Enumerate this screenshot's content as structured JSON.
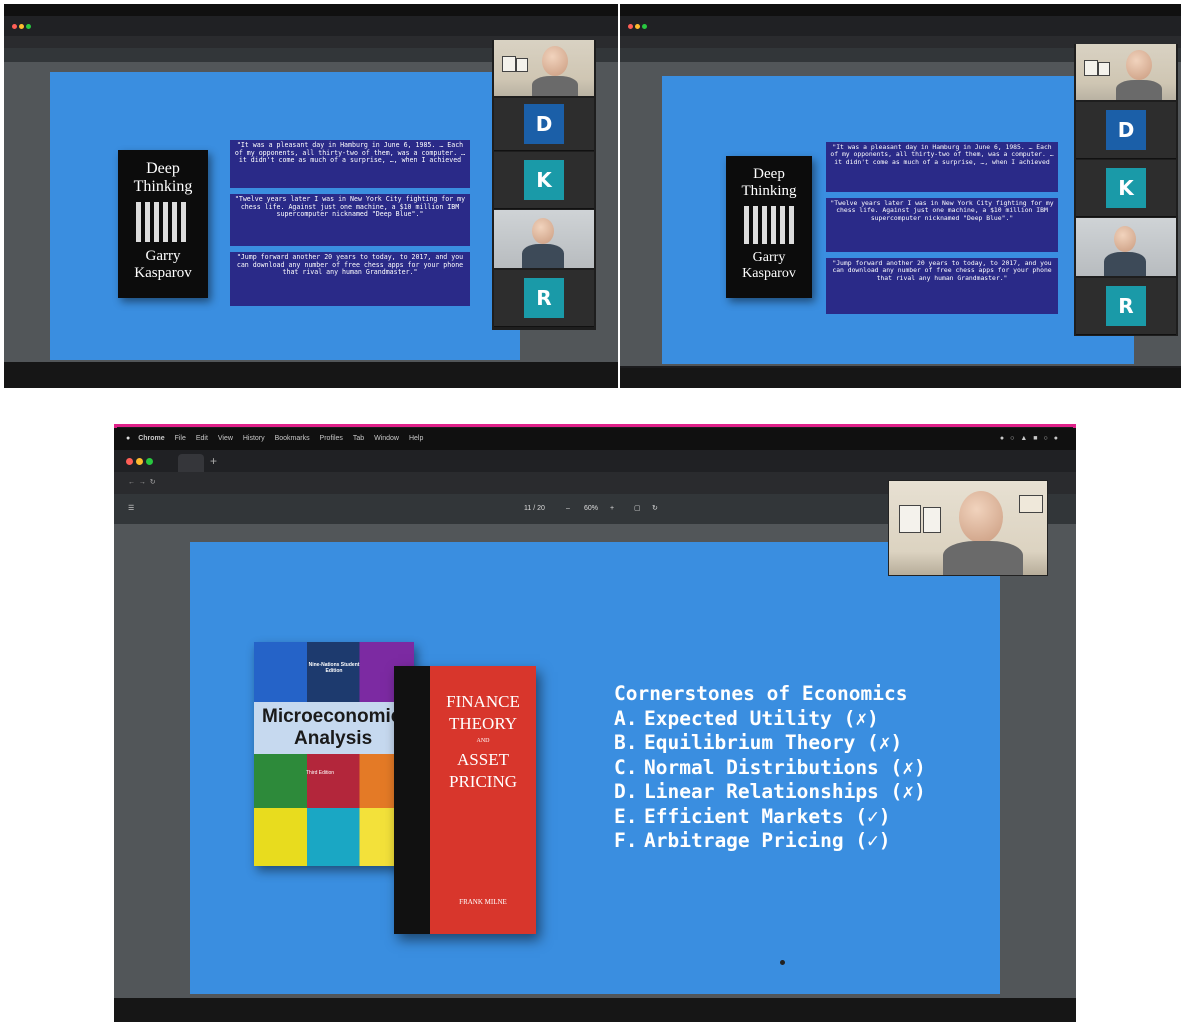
{
  "top_left": {
    "quotes": [
      "\"It was a pleasant day in Hamburg in June 6, 1985. … Each of my opponents, all thirty-two of them, was a computer. … it didn't come as much of a surprise, …, when I achieved",
      "\"Twelve years later I was in New York City fighting for my chess life. Against just one machine, a $10 million IBM supercomputer nicknamed \"Deep Blue\".\"",
      "\"Jump forward another 20 years to today, to 2017, and you can download any number of free chess apps for your phone that rival any human Grandmaster.\""
    ],
    "book": {
      "title1": "Deep",
      "title2": "Thinking",
      "author1": "Garry",
      "author2": "Kasparov"
    },
    "participants": [
      "D",
      "K",
      "R"
    ]
  },
  "top_right": {
    "quotes": [
      "\"It was a pleasant day in Hamburg in June 6, 1985. … Each of my opponents, all thirty-two of them, was a computer. … it didn't come as much of a surprise, …, when I achieved",
      "\"Twelve years later I was in New York City fighting for my chess life. Against just one machine, a $10 million IBM supercomputer nicknamed \"Deep Blue\".\"",
      "\"Jump forward another 20 years to today, to 2017, and you can download any number of free chess apps for your phone that rival any human Grandmaster.\""
    ],
    "book": {
      "title1": "Deep",
      "title2": "Thinking",
      "author1": "Garry",
      "author2": "Kasparov"
    },
    "participants": [
      "D",
      "K",
      "R"
    ]
  },
  "bottom": {
    "menubar": [
      "Chrome",
      "File",
      "Edit",
      "View",
      "History",
      "Bookmarks",
      "Profiles",
      "Tab",
      "Window",
      "Help"
    ],
    "pdf_toolbar": {
      "page": "11 / 20",
      "zoom": "60%"
    },
    "book1": {
      "edition_note": "Nine-Nations Student Edition",
      "title_line1": "Microeconomic",
      "title_line2": "Analysis",
      "edition": "Third Edition"
    },
    "book2": {
      "title": [
        "FINANCE",
        "THEORY",
        "AND",
        "ASSET",
        "PRICING"
      ],
      "author": "FRANK MILNE"
    },
    "heading": "Cornerstones of Economics",
    "items": [
      {
        "letter": "A.",
        "text": "Expected Utility (✗)"
      },
      {
        "letter": "B.",
        "text": "Equilibrium Theory (✗)"
      },
      {
        "letter": "C.",
        "text": "Normal Distributions (✗)"
      },
      {
        "letter": "D.",
        "text": "Linear Relationships (✗)"
      },
      {
        "letter": "E.",
        "text": "Efficient Markets (✓)"
      },
      {
        "letter": "F.",
        "text": "Arbitrage Pricing (✓)"
      }
    ]
  },
  "colors": {
    "slide_blue": "#3a8ee0",
    "quote_navy": "#2a2a88",
    "tile_blue": "#1b5fa8",
    "tile_teal": "#1a9aa8",
    "highlight_pink": "#e0218a"
  }
}
